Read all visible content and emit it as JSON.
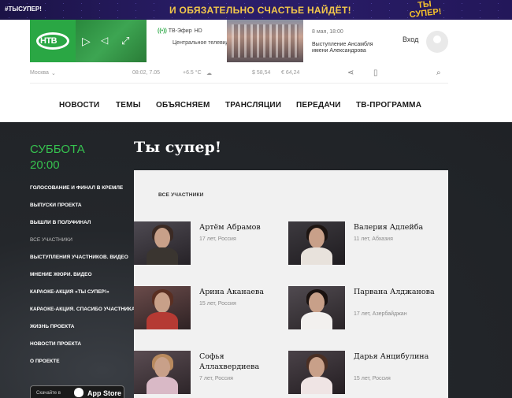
{
  "banner": {
    "hashtag": "#ТЫСУПЕР!",
    "slogan": "И ОБЯЗАТЕЛЬНО СЧАСТЬЕ НАЙДЁТ!",
    "logo_text": "ТЫ СУПЕР!"
  },
  "header": {
    "logo_text": "НТВ",
    "live_label": "ТВ-Эфир",
    "live_hd": "HD",
    "live_channel": "Центральное телевидение",
    "news_date": "8 мая, 18:00",
    "news_title": "Выступление Ансамбля имени Александрова",
    "login_label": "Вход"
  },
  "infobar": {
    "city": "Москва",
    "datetime": "08:02, 7.05",
    "weather": "+6.5 °C",
    "usd": "$ 58,54",
    "eur": "€ 64,24"
  },
  "nav": [
    "НОВОСТИ",
    "ТЕМЫ",
    "ОБЪЯСНЯЕМ",
    "ТРАНСЛЯЦИИ",
    "ПЕРЕДАЧИ",
    "ТВ-ПРОГРАММА"
  ],
  "sidebar": {
    "day": "СУББОТА",
    "time": "20:00",
    "links": [
      "ГОЛОСОВАНИЕ И ФИНАЛ В КРЕМЛЕ",
      "ВЫПУСКИ ПРОЕКТА",
      "ВЫШЛИ В ПОЛУФИНАЛ",
      "ВСЕ УЧАСТНИКИ",
      "ВЫСТУПЛЕНИЯ УЧАСТНИКОВ. ВИДЕО",
      "МНЕНИЕ ЖЮРИ. ВИДЕО",
      "КАРАОКЕ-АКЦИЯ «ТЫ СУПЕР!»",
      "КАРАОКЕ-АКЦИЯ. СПАСИБО УЧАСТНИКАМ!",
      "ЖИЗНЬ ПРОЕКТА",
      "НОВОСТИ ПРОЕКТА",
      "О ПРОЕКТЕ"
    ],
    "download_label": "Скачайте в",
    "store_label": "App Store"
  },
  "main": {
    "title": "Ты супер!",
    "section_label": "ВСЕ УЧАСТНИКИ",
    "participants": [
      {
        "name": "Артём Абрамов",
        "meta": "17 лет, Россия"
      },
      {
        "name": "Валерия Адлейба",
        "meta": "11 лет, Абхазия"
      },
      {
        "name": "Арина Аканаева",
        "meta": "15 лет, Россия"
      },
      {
        "name": "Парвана Алджанова",
        "meta": "17 лет, Азербайджан"
      },
      {
        "name": "Софья Аллахвердиева",
        "meta": "7 лет, Россия"
      },
      {
        "name": "Дарья Анцибулина",
        "meta": "15 лет, Россия"
      }
    ]
  },
  "colors": {
    "accent_green": "#2aa744",
    "banner_gold": "#f3c84a"
  }
}
